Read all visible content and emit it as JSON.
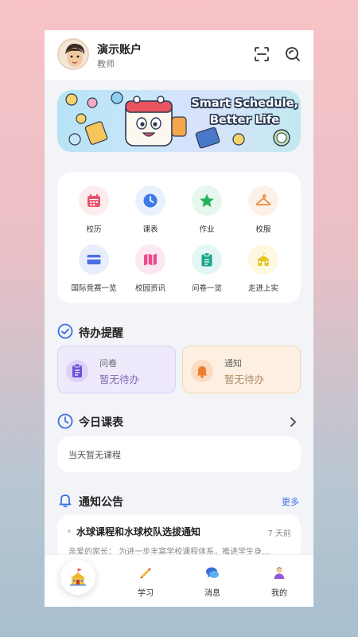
{
  "header": {
    "name": "演示账户",
    "role": "教师",
    "scan_icon": "scan-icon",
    "search_icon": "search-icon"
  },
  "banner": {
    "line1": "Smart Schedule,",
    "line2": "Better Life"
  },
  "quick_menu": [
    {
      "label": "校历",
      "icon": "calendar-icon",
      "bg": "#fdeced",
      "color": "#e8546b"
    },
    {
      "label": "课表",
      "icon": "clock-icon",
      "bg": "#e8f1fd",
      "color": "#3d7be6"
    },
    {
      "label": "作业",
      "icon": "star-icon",
      "bg": "#e7f7ee",
      "color": "#22b35c"
    },
    {
      "label": "校服",
      "icon": "hanger-icon",
      "bg": "#fdf0e6",
      "color": "#ef8a3d"
    },
    {
      "label": "国际竞赛一览",
      "icon": "card-icon",
      "bg": "#e9eefc",
      "color": "#4d6fe0"
    },
    {
      "label": "校园资讯",
      "icon": "map-icon",
      "bg": "#fce8f1",
      "color": "#ea4d8c"
    },
    {
      "label": "问卷一览",
      "icon": "clipboard-icon",
      "bg": "#e4f6f3",
      "color": "#1aa68e"
    },
    {
      "label": "走进上实",
      "icon": "school-icon",
      "bg": "#fdf8e0",
      "color": "#e7c524"
    }
  ],
  "todo": {
    "title": "待办提醒",
    "questionnaire": {
      "label": "问卷",
      "status": "暂无待办"
    },
    "notice": {
      "label": "通知",
      "status": "暂无待办"
    }
  },
  "schedule": {
    "title": "今日课表",
    "empty": "当天暂无课程"
  },
  "announcements": {
    "title": "通知公告",
    "more": "更多",
    "items": [
      {
        "title": "水球课程和水球校队选拔通知",
        "time": "7 天前",
        "excerpt": "亲爱的家长：  为进一步丰富学校课程体系，推进学生身..."
      }
    ]
  },
  "tabbar": {
    "tabs": [
      {
        "label": "学习",
        "icon": "pencil-icon"
      },
      {
        "label": "消息",
        "icon": "chat-icon"
      },
      {
        "label": "我的",
        "icon": "profile-icon"
      }
    ]
  },
  "colors": {
    "accent": "#3d6fe0",
    "todo_purple_bg": "#efe9fc",
    "todo_orange_bg": "#fdf0e2"
  }
}
